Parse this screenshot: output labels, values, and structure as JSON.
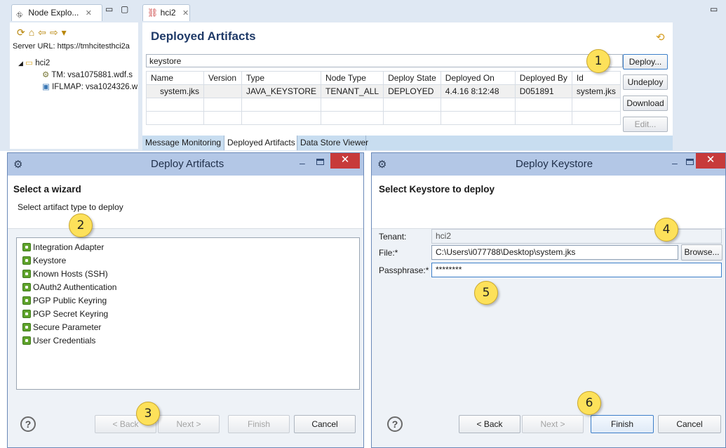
{
  "top": {
    "node_explorer_tab": "Node Explo...",
    "server_url": "Server URL: https://tmhcitesthci2a",
    "tree": {
      "root": "hci2",
      "tm": "TM: vsa1075881.wdf.s",
      "iflmap": "IFLMAP: vsa1024326.w"
    },
    "editor_tab": "hci2",
    "editor_title": "Deployed Artifacts",
    "filter_value": "keystore",
    "columns": [
      "Name",
      "Version",
      "Type",
      "Node Type",
      "Deploy State",
      "Deployed On",
      "Deployed By",
      "Id"
    ],
    "rows": [
      [
        "system.jks",
        "",
        "JAVA_KEYSTORE",
        "TENANT_ALL",
        "DEPLOYED",
        "4.4.16 8:12:48",
        "D051891",
        "system.jks"
      ]
    ],
    "buttons": {
      "deploy": "Deploy...",
      "undeploy": "Undeploy",
      "download": "Download",
      "edit": "Edit..."
    },
    "bottom_tabs": [
      "Message Monitoring",
      "Deployed Artifacts",
      "Data Store Viewer"
    ]
  },
  "wizard": {
    "title": "Deploy Artifacts",
    "heading": "Select a wizard",
    "subheading": "Select artifact type to deploy",
    "items": [
      "Integration Adapter",
      "Keystore",
      "Known Hosts (SSH)",
      "OAuth2 Authentication",
      "PGP Public Keyring",
      "PGP Secret Keyring",
      "Secure Parameter",
      "User Credentials"
    ],
    "buttons": {
      "help": "?",
      "back": "< Back",
      "next": "Next >",
      "finish": "Finish",
      "cancel": "Cancel"
    }
  },
  "keystore": {
    "title": "Deploy Keystore",
    "heading": "Select Keystore to deploy",
    "tenant_label": "Tenant:",
    "tenant_value": "hci2",
    "file_label": "File:*",
    "file_value": "C:\\Users\\i077788\\Desktop\\system.jks",
    "browse": "Browse...",
    "pass_label": "Passphrase:*",
    "pass_value": "********",
    "buttons": {
      "help": "?",
      "back": "< Back",
      "next": "Next >",
      "finish": "Finish",
      "cancel": "Cancel"
    }
  },
  "callouts": [
    "1",
    "2",
    "3",
    "4",
    "5",
    "6"
  ],
  "colors": {
    "titlebar": "#b3c7e6",
    "callout": "#fde15a",
    "close": "#c73a3a",
    "editor_title": "#1f3a68"
  }
}
